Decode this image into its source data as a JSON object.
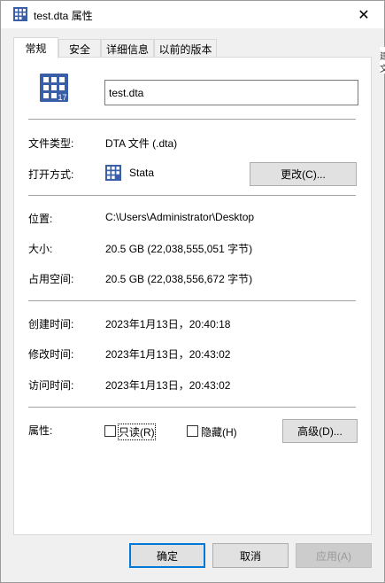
{
  "window": {
    "title": "test.dta 属性",
    "close_glyph": "✕"
  },
  "tabs": [
    {
      "label": "常规",
      "active": true
    },
    {
      "label": "安全",
      "active": false
    },
    {
      "label": "详细信息",
      "active": false
    },
    {
      "label": "以前的版本",
      "active": false
    }
  ],
  "general": {
    "file_name": "test.dta",
    "icon_badge": "17",
    "file_type_label": "文件类型:",
    "file_type_value": "DTA 文件 (.dta)",
    "open_with_label": "打开方式:",
    "open_with_value": "Stata",
    "change_button": "更改(C)...",
    "location_label": "位置:",
    "location_value": "C:\\Users\\Administrator\\Desktop",
    "size_label": "大小:",
    "size_value": "20.5 GB (22,038,555,051 字节)",
    "size_on_disk_label": "占用空间:",
    "size_on_disk_value": "20.5 GB (22,038,556,672 字节)",
    "created_label": "创建时间:",
    "created_value": "2023年1月13日，20:40:18",
    "modified_label": "修改时间:",
    "modified_value": "2023年1月13日，20:43:02",
    "accessed_label": "访问时间:",
    "accessed_value": "2023年1月13日，20:43:02",
    "attributes_label": "属性:",
    "readonly_label": "只读(R)",
    "readonly_checked": false,
    "hidden_label": "隐藏(H)",
    "hidden_checked": false,
    "advanced_button": "高级(D)..."
  },
  "footer": {
    "ok_button": "确定",
    "cancel_button": "取消",
    "apply_button": "应用(A)"
  },
  "background_fragment": {
    "line1": "建",
    "line2": "文"
  },
  "colors": {
    "stata_blue": "#2f5597",
    "focus_border": "#0078d7"
  }
}
